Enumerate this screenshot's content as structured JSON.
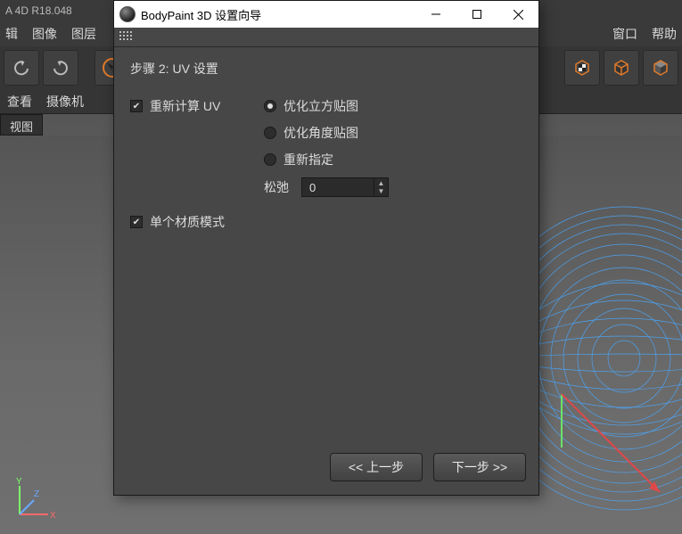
{
  "app_strip": {
    "title": "A 4D R18.048"
  },
  "menu": {
    "items_left": [
      "辑",
      "图像",
      "图层"
    ],
    "items_right": [
      "窗口",
      "帮助"
    ]
  },
  "sub_row": {
    "items": [
      "查看",
      "摄像机"
    ]
  },
  "view_label": "视图",
  "toolbar": {
    "left_icons": [
      "undo-icon",
      "redo-icon",
      "cursor-icon",
      "move-icon"
    ],
    "right_icons": [
      "checker-icon",
      "cube-wire-icon",
      "cube-solid-icon"
    ]
  },
  "dialog": {
    "title": "BodyPaint 3D 设置向导",
    "step_title": "步骤 2: UV 设置",
    "recalc_uv_label": "重新计算 UV",
    "recalc_uv_checked": true,
    "opt1_label": "优化立方贴图",
    "opt2_label": "优化角度贴图",
    "opt3_label": "重新指定",
    "selected_option": 0,
    "relax_label": "松弛",
    "relax_value": "0",
    "single_mat_label": "单个材质模式",
    "single_mat_checked": true,
    "prev_label": "<< 上一步",
    "next_label": "下一步 >>"
  }
}
